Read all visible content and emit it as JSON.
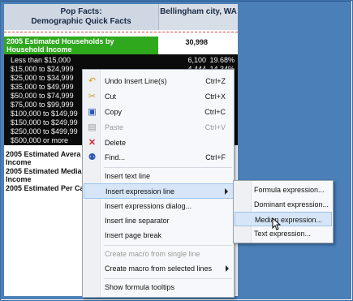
{
  "report": {
    "header_left_line1": "Pop Facts:",
    "header_left_line2": "Demographic Quick Facts",
    "header_right": "Bellingham city, WA",
    "households_label_line1": "2005 Estimated Households by",
    "households_label_line2": "Household Income",
    "households_total": "30,998",
    "income_rows": [
      {
        "label": "Less than $15,000",
        "count": "6,100",
        "pct": "19.68%"
      },
      {
        "label": "$15,000 to $24,999",
        "count": "4,444",
        "pct": "14.34%"
      },
      {
        "label": "$25,000 to $34,999",
        "count": "",
        "pct": ""
      },
      {
        "label": "$35,000 to $49,999",
        "count": "",
        "pct": "%"
      },
      {
        "label": "$50,000 to $74,999",
        "count": "",
        "pct": "%"
      },
      {
        "label": "$75,000 to $99,999",
        "count": "",
        "pct": "%"
      },
      {
        "label": "$100,000 to $149,99",
        "count": "",
        "pct": "%"
      },
      {
        "label": "$150,000 to $249,99",
        "count": "",
        "pct": "%"
      },
      {
        "label": "$250,000 to $499,99",
        "count": "",
        "pct": "%"
      },
      {
        "label": "$500,000 or more",
        "count": "",
        "pct": "%"
      }
    ],
    "avg_label_line1": "2005 Estimated Avera",
    "avg_label_line2": "Income",
    "median_label_line1": "2005 Estimated Media",
    "median_label_line2": "Income",
    "percap_label": "2005 Estimated Per Ca"
  },
  "context_menu": {
    "undo": {
      "label": "Undo Insert Line(s)",
      "shortcut": "Ctrl+Z",
      "icon": "undo-icon"
    },
    "cut": {
      "label": "Cut",
      "shortcut": "Ctrl+X",
      "icon": "scissors-icon"
    },
    "copy": {
      "label": "Copy",
      "shortcut": "Ctrl+C",
      "icon": "copy-icon"
    },
    "paste": {
      "label": "Paste",
      "shortcut": "Ctrl+V",
      "icon": "paste-icon"
    },
    "delete": {
      "label": "Delete",
      "icon": "delete-icon"
    },
    "find": {
      "label": "Find...",
      "shortcut": "Ctrl+F",
      "icon": "binoculars-icon"
    },
    "insert_text_line": "Insert text line",
    "insert_expression_line": "Insert expression line",
    "insert_expressions_dialog": "Insert expressions dialog...",
    "insert_line_separator": "Insert line separator",
    "insert_page_break": "Insert page break",
    "create_macro_single": "Create macro from single line",
    "create_macro_selected": "Create macro from selected lines",
    "show_formula_tooltips": "Show formula tooltips"
  },
  "submenu": {
    "formula": "Formula expression...",
    "dominant": "Dominant expression...",
    "median": "Median expression...",
    "text": "Text expression..."
  },
  "colors": {
    "background_blue": "#4a7fb8",
    "header_green": "#2fa81e",
    "highlight": "#d6e6f8"
  }
}
